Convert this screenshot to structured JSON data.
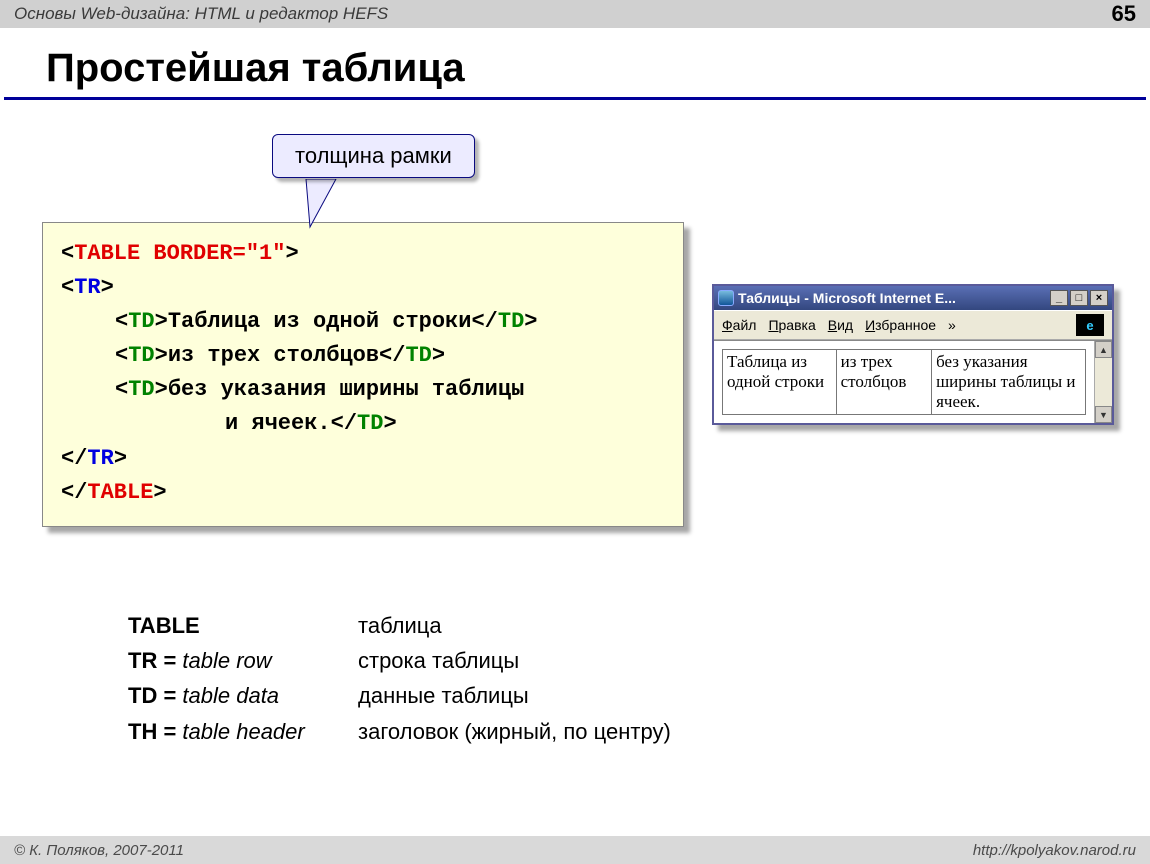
{
  "header": {
    "title": "Основы Web-дизайна: HTML и редактор HEFS",
    "page": "65"
  },
  "slide_title": "Простейшая таблица",
  "callout": "толщина рамки",
  "code": {
    "table_open_pre": "<",
    "table_open_kw": "TABLE BORDER=\"1\"",
    "table_open_post": ">",
    "tr_open_pre": "<",
    "tr_open_kw": "TR",
    "tr_open_post": ">",
    "td_kw": "TD",
    "cell1": "Таблица из одной строки",
    "cell2": "из трех столбцов",
    "cell3a": "без указания ширины таблицы",
    "cell3b": "и ячеек.",
    "tr_close_pre": "</",
    "tr_close_post": ">",
    "table_close_kw": "TABLE"
  },
  "browser": {
    "title": "Таблицы - Microsoft Internet E...",
    "menu": {
      "file": "Файл",
      "edit": "Правка",
      "view": "Вид",
      "fav": "Избранное",
      "more": "»"
    },
    "cells": [
      "Таблица из одной строки",
      "из трех столбцов",
      "без указания ширины таблицы и ячеек."
    ]
  },
  "defs": [
    {
      "term_html": "<b>TABLE</b>",
      "desc": "таблица"
    },
    {
      "term_html": "<b>TR = </b><i>table row</i>",
      "desc": "строка таблицы"
    },
    {
      "term_html": "<b>TD = </b><i>table data</i>",
      "desc": "данные таблицы"
    },
    {
      "term_html": "<b>TH = </b><i>table header</i>",
      "desc": "заголовок (жирный, по центру)"
    }
  ],
  "footer": {
    "left": "© К. Поляков, 2007-2011",
    "right": "http://kpolyakov.narod.ru"
  }
}
